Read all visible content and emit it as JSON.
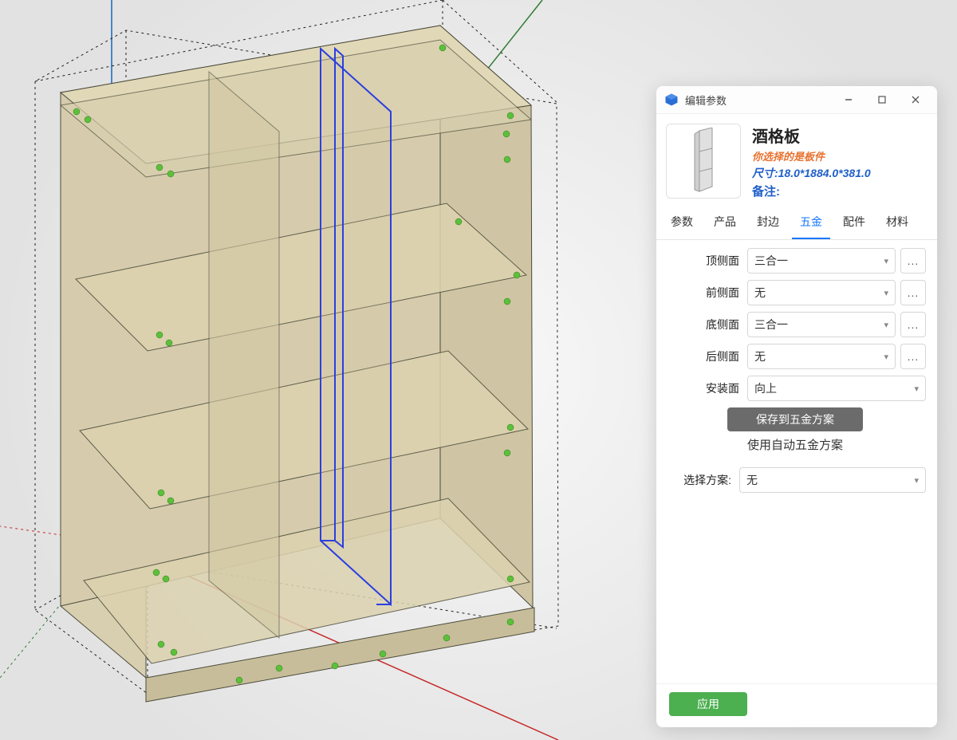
{
  "window": {
    "title": "编辑参数"
  },
  "header": {
    "name": "酒格板",
    "subtitle": "你选择的是板件",
    "dims_label": "尺寸:",
    "dims_value": "18.0*1884.0*381.0",
    "remark_label": "备注:"
  },
  "tabs": [
    {
      "id": "params",
      "label": "参数",
      "active": false
    },
    {
      "id": "product",
      "label": "产品",
      "active": false
    },
    {
      "id": "edge",
      "label": "封边",
      "active": false
    },
    {
      "id": "hardware",
      "label": "五金",
      "active": true
    },
    {
      "id": "acc",
      "label": "配件",
      "active": false
    },
    {
      "id": "material",
      "label": "材料",
      "active": false
    }
  ],
  "form": {
    "top_side": {
      "label": "顶侧面",
      "value": "三合一"
    },
    "front_side": {
      "label": "前侧面",
      "value": "无"
    },
    "bottom_side": {
      "label": "底侧面",
      "value": "三合一"
    },
    "back_side": {
      "label": "后侧面",
      "value": "无"
    },
    "install": {
      "label": "安装面",
      "value": "向上"
    },
    "save_scheme_label": "保存到五金方案",
    "auto_scheme_label": "使用自动五金方案",
    "select_scheme_label": "选择方案:",
    "select_scheme_value": "无",
    "more_label": "..."
  },
  "footer": {
    "apply_label": "应用"
  }
}
